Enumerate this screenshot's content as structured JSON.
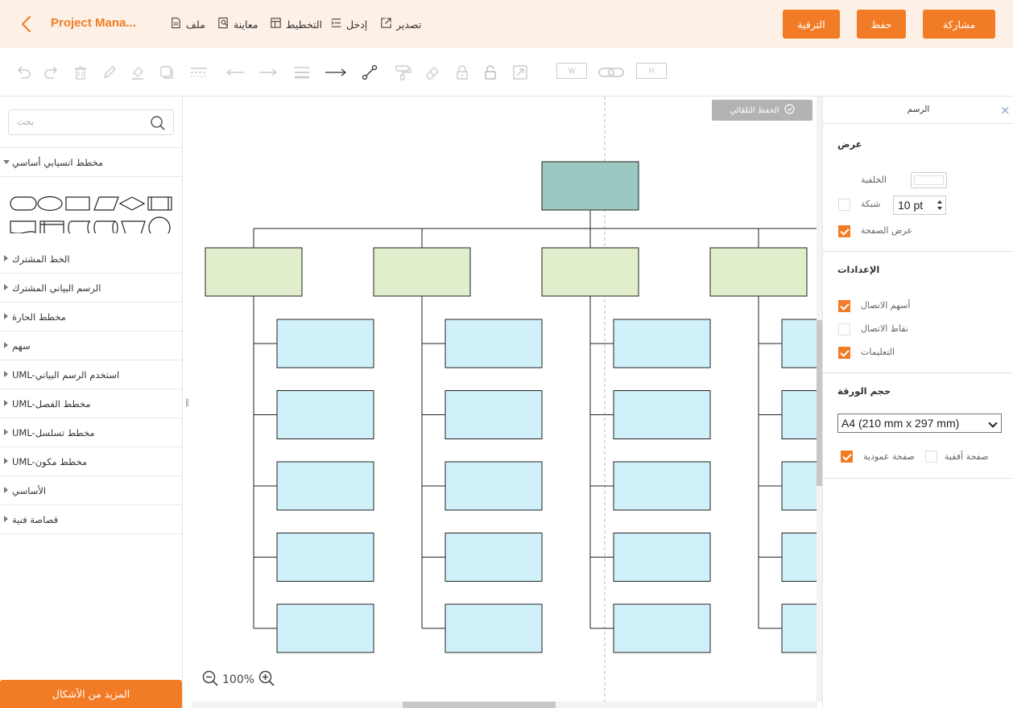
{
  "header": {
    "title": "Project Mana...",
    "menu": {
      "file": "ملف",
      "preview": "معاينة",
      "layout": "التخطيط",
      "insert": "إدخل",
      "export": "تصدير"
    },
    "buttons": {
      "upgrade": "الترقية",
      "save": "حفظ",
      "share": "مشاركة"
    }
  },
  "toolbar": {
    "width_box": "W",
    "height_box": "H"
  },
  "left": {
    "search_placeholder": "بحث",
    "open_section": "مخطط انسيابي أساسي",
    "categories": [
      "الخط المشترك",
      "الرسم البياني المشترك",
      "مخطط الحارة",
      "سهم",
      "UML-استخدم الرسم البياني",
      "UML-مخطط الفصل",
      "UML-مخطط تسلسل",
      "UML-مخطط مكون",
      "الأساسي",
      "قصاصة فنية"
    ],
    "more_shapes": "المزيد من الأشكال"
  },
  "canvas": {
    "autosave": "الحفظ التلقائي",
    "zoom": "100%"
  },
  "right": {
    "title": "الرسم",
    "display_heading": "عرض",
    "background_label": "الخلفية",
    "grid_label": "شبكة",
    "grid_size": "10 pt",
    "page_view_label": "عرض الصفحة",
    "settings_heading": "الإعدادات",
    "connection_arrows": "أسهم الاتصال",
    "connection_points": "نقاط الاتصال",
    "guides": "التعليمات",
    "paper_size_heading": "حجم الورقة",
    "paper_size": "A4 (210 mm x 297 mm)",
    "portrait": "صفحة عمودية",
    "landscape": "صفحة أفقية",
    "checks": {
      "grid": false,
      "page_view": true,
      "connection_arrows": true,
      "connection_points": false,
      "guides": true,
      "portrait": true,
      "landscape": false
    }
  },
  "colors": {
    "accent": "#f27c26",
    "header_bg": "#fdf0e6",
    "root_fill": "#9bc8c1",
    "level1_fill": "#e1eecb",
    "level2_fill": "#d0f1fa"
  }
}
